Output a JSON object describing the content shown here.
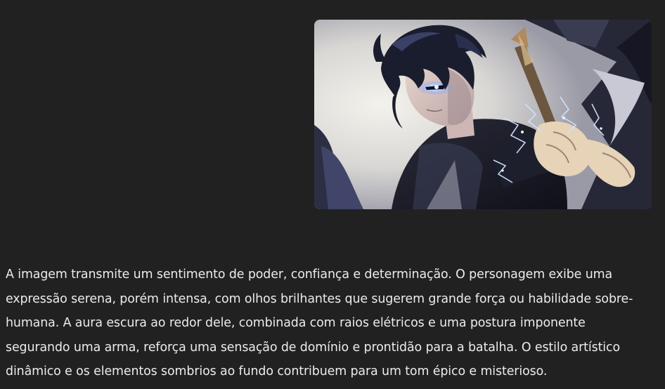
{
  "conversation": {
    "user_message": {
      "image": {
        "kind": "anime-illustration",
        "subject": "dark-haired character with glowing eye holding a weapon amid lightning"
      }
    },
    "assistant_message": {
      "text": "A imagem transmite um sentimento de poder, confiança e determinação. O personagem exibe uma expressão serena, porém intensa, com olhos brilhantes que sugerem grande força ou habilidade sobre-humana. A aura escura ao redor dele, combinada com raios elétricos e uma postura imponente segurando uma arma, reforça uma sensação de domínio e prontidão para a batalha. O estilo artístico dinâmico e os elementos sombrios ao fundo contribuem para um tom épico e misterioso."
    }
  },
  "colors": {
    "background": "#212121",
    "text": "#ececec",
    "eye_glow": "#9fc6ff"
  }
}
